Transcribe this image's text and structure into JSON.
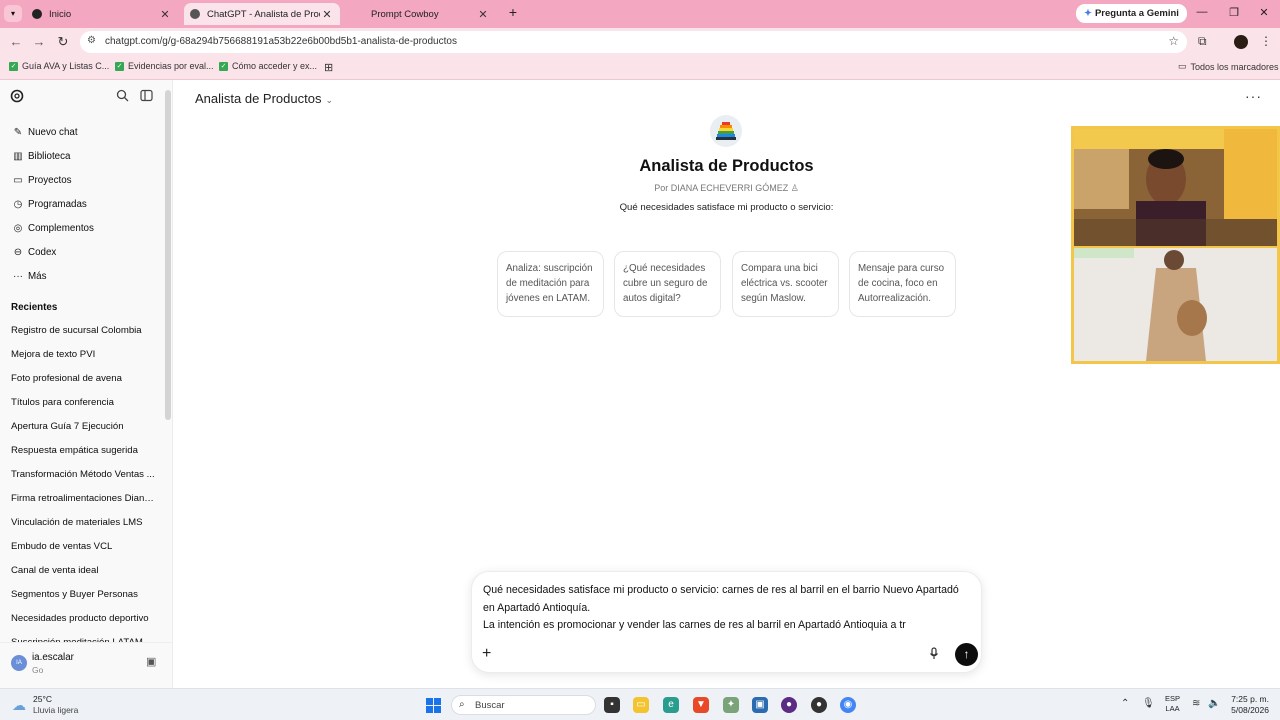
{
  "browser": {
    "tabs": [
      {
        "label": "Inicio",
        "close": "✕"
      },
      {
        "label": "ChatGPT - Analista de Producto",
        "close": "✕"
      },
      {
        "label": "Prompt Cowboy",
        "close": "✕"
      }
    ],
    "new_tab": "+",
    "gemini_label": "Pregunta a Gemini",
    "url": "chatgpt.com/g/g-68a294b756688191a53b22e6b00bd5b1-analista-de-productos",
    "bookmarks": [
      "Guía AVA y Listas C...",
      "Evidencias por eval...",
      "Cómo acceder y ex..."
    ],
    "all_bookmarks": "Todos los marcadores"
  },
  "sidebar": {
    "nav": [
      {
        "label": "Nuevo chat",
        "icon": "edit-icon"
      },
      {
        "label": "Biblioteca",
        "icon": "library-icon"
      },
      {
        "label": "Proyectos",
        "icon": "folder-icon"
      },
      {
        "label": "Programadas",
        "icon": "clock-icon"
      },
      {
        "label": "Complementos",
        "icon": "plugin-icon"
      },
      {
        "label": "Codex",
        "icon": "codex-icon"
      },
      {
        "label": "Más",
        "icon": "more-icon"
      }
    ],
    "recent_title": "Recientes",
    "recent": [
      "Registro de sucursal Colombia",
      "Mejora de texto PVI",
      "Foto profesional de avena",
      "Títulos para conferencia",
      "Apertura Guía 7 Ejecución",
      "Respuesta empática sugerida",
      "Transformación Método Ventas ...",
      "Firma retroalimentaciones Diana...",
      "Vinculación de materiales LMS",
      "Embudo de ventas VCL",
      "Canal de venta ideal",
      "Segmentos y Buyer Personas",
      "Necesidades producto deportivo",
      "Suscripción meditación LATAM"
    ],
    "user": {
      "initials": "IA",
      "name": "ia.escalar",
      "plan": "Go"
    }
  },
  "main": {
    "model_label": "Analista de Productos",
    "gpt_title": "Analista de Productos",
    "gpt_author": "Por DIANA ECHEVERRI GÓMEZ",
    "gpt_description": "Qué necesidades satisface mi producto o servicio:",
    "starters": [
      "Analiza: suscripción de meditación para jóvenes en LATAM.",
      "¿Qué necesidades cubre un seguro de autos digital?",
      "Compara una bici eléctrica vs. scooter según Maslow.",
      "Mensaje para curso de cocina, foco en Autorrealización."
    ],
    "composer_lines": [
      "Qué necesidades satisface mi producto o servicio: carnes de res al barril en el barrio Nuevo Apartadó en Apartadó Antioquía.",
      "La intención es promocionar y vender las carnes de res al barril en Apartadó Antioquia a tr"
    ]
  },
  "taskbar": {
    "temperature": "25°C",
    "weather": "Lluvia ligera",
    "search_label": "Buscar",
    "lang_top": "ESP",
    "lang_bottom": "LAA",
    "time": "7:25 p. m.",
    "date": "5/08/2026"
  },
  "colors": {
    "tabbar": "#f4a7c0",
    "chrome": "#fbe3ea",
    "send_button": "#0d0d0d",
    "cam_border": "#f3c64a"
  }
}
